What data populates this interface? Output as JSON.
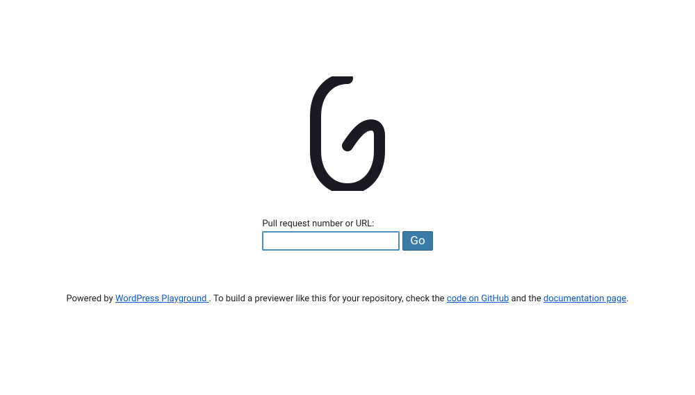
{
  "form": {
    "label": "Pull request number or URL:",
    "input_value": "",
    "button_label": "Go"
  },
  "footer": {
    "prefix": "Powered by ",
    "link1": "WordPress Playground ",
    "mid1": ". To build a previewer like this for your repository, check the ",
    "link2": "code on GitHub",
    "mid2": " and the ",
    "link3": "documentation page",
    "suffix": "."
  }
}
